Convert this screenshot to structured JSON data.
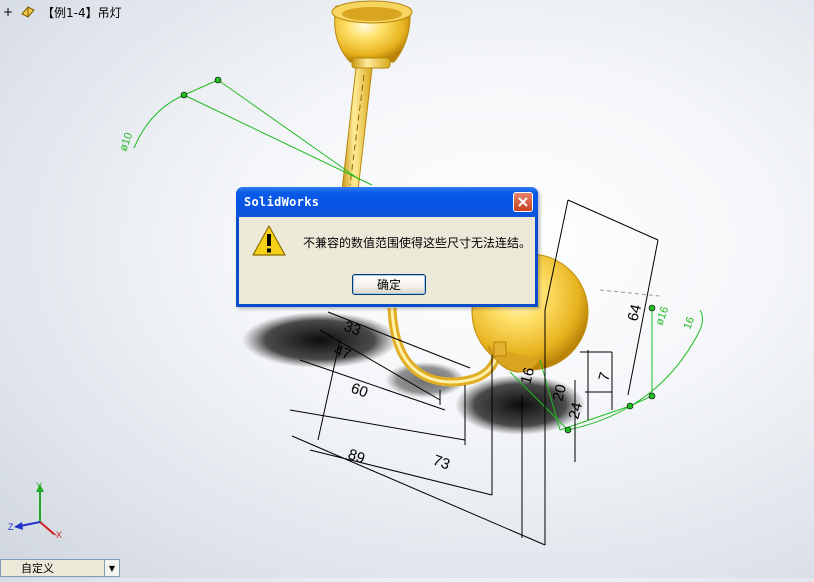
{
  "tree": {
    "expander": "+",
    "title": "【例1-4】吊灯",
    "icon": "part-icon"
  },
  "model": {
    "dimensions": [
      "33",
      "47",
      "60",
      "89",
      "73",
      "16",
      "20",
      "24",
      "7",
      "64"
    ],
    "green_labels": [
      "ø10",
      "ø16",
      "16"
    ]
  },
  "dialog": {
    "title": "SolidWorks",
    "message": "不兼容的数值范围使得这些尺寸无法连结。",
    "ok_label": "确定",
    "icon": "warning-icon"
  },
  "triad": {
    "x": "X",
    "y": "Y",
    "z": "Z"
  },
  "view_selector": {
    "value": "自定义"
  },
  "colors": {
    "titlebar": "#0654e4",
    "dialog_body": "#ece9d8",
    "sketch_green": "#22bb22",
    "gold": "#f2c94c"
  }
}
